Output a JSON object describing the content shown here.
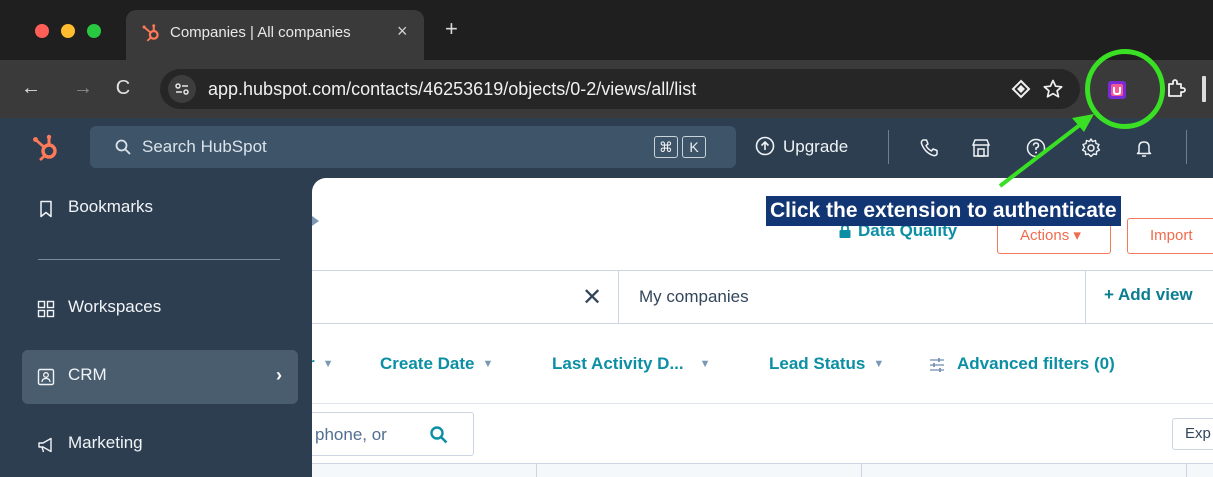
{
  "browser": {
    "tab_title": "Companies | All companies",
    "tab_close": "×",
    "new_tab": "+",
    "back": "←",
    "forward": "→",
    "reload": "C",
    "url": "app.hubspot.com/contacts/46253619/objects/0-2/views/all/list"
  },
  "hubspot_bar": {
    "search_placeholder": "Search HubSpot",
    "kbd_cmd": "⌘",
    "kbd_k": "K",
    "upgrade": "Upgrade"
  },
  "leftnav": {
    "items": [
      {
        "label": "Bookmarks"
      },
      {
        "label": "Workspaces"
      },
      {
        "label": "CRM",
        "chevron": "›"
      },
      {
        "label": "Marketing"
      }
    ]
  },
  "content": {
    "data_quality": "Data Quality",
    "actions": "Actions ▾",
    "import": "Import",
    "view_close": "✕",
    "view_tab": "My companies",
    "add_view": "+  Add view",
    "filters": {
      "partial": "r",
      "create_date": "Create Date",
      "last_activity": "Last Activity D...",
      "lead_status": "Lead Status",
      "advanced": "Advanced filters (0)"
    },
    "search_partial": "phone, or",
    "export": "Exp"
  },
  "annotation": {
    "label": "Click the extension to authenticate",
    "color": "#39e024",
    "label_bg": "#123674"
  }
}
